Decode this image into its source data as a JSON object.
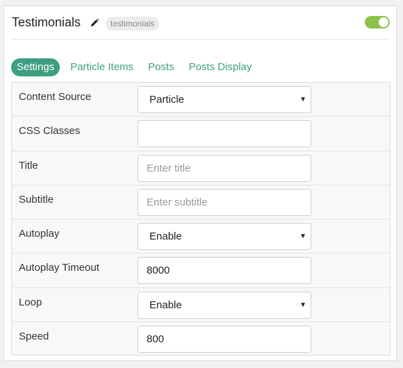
{
  "header": {
    "title": "Testimonials",
    "badge": "testimonials",
    "toggle_on": true,
    "colors": {
      "toggle": "#8bc34a",
      "accent": "#3d9e81"
    }
  },
  "tabs": [
    {
      "label": "Settings",
      "active": true
    },
    {
      "label": "Particle Items",
      "active": false
    },
    {
      "label": "Posts",
      "active": false
    },
    {
      "label": "Posts Display",
      "active": false
    }
  ],
  "fields": [
    {
      "label": "Content Source",
      "type": "select",
      "value": "Particle"
    },
    {
      "label": "CSS Classes",
      "type": "text",
      "value": ""
    },
    {
      "label": "Title",
      "type": "text",
      "placeholder": "Enter title"
    },
    {
      "label": "Subtitle",
      "type": "text",
      "placeholder": "Enter subtitle"
    },
    {
      "label": "Autoplay",
      "type": "select",
      "value": "Enable"
    },
    {
      "label": "Autoplay Timeout",
      "type": "text",
      "value": "8000"
    },
    {
      "label": "Loop",
      "type": "select",
      "value": "Enable"
    },
    {
      "label": "Speed",
      "type": "text",
      "value": "800"
    }
  ]
}
